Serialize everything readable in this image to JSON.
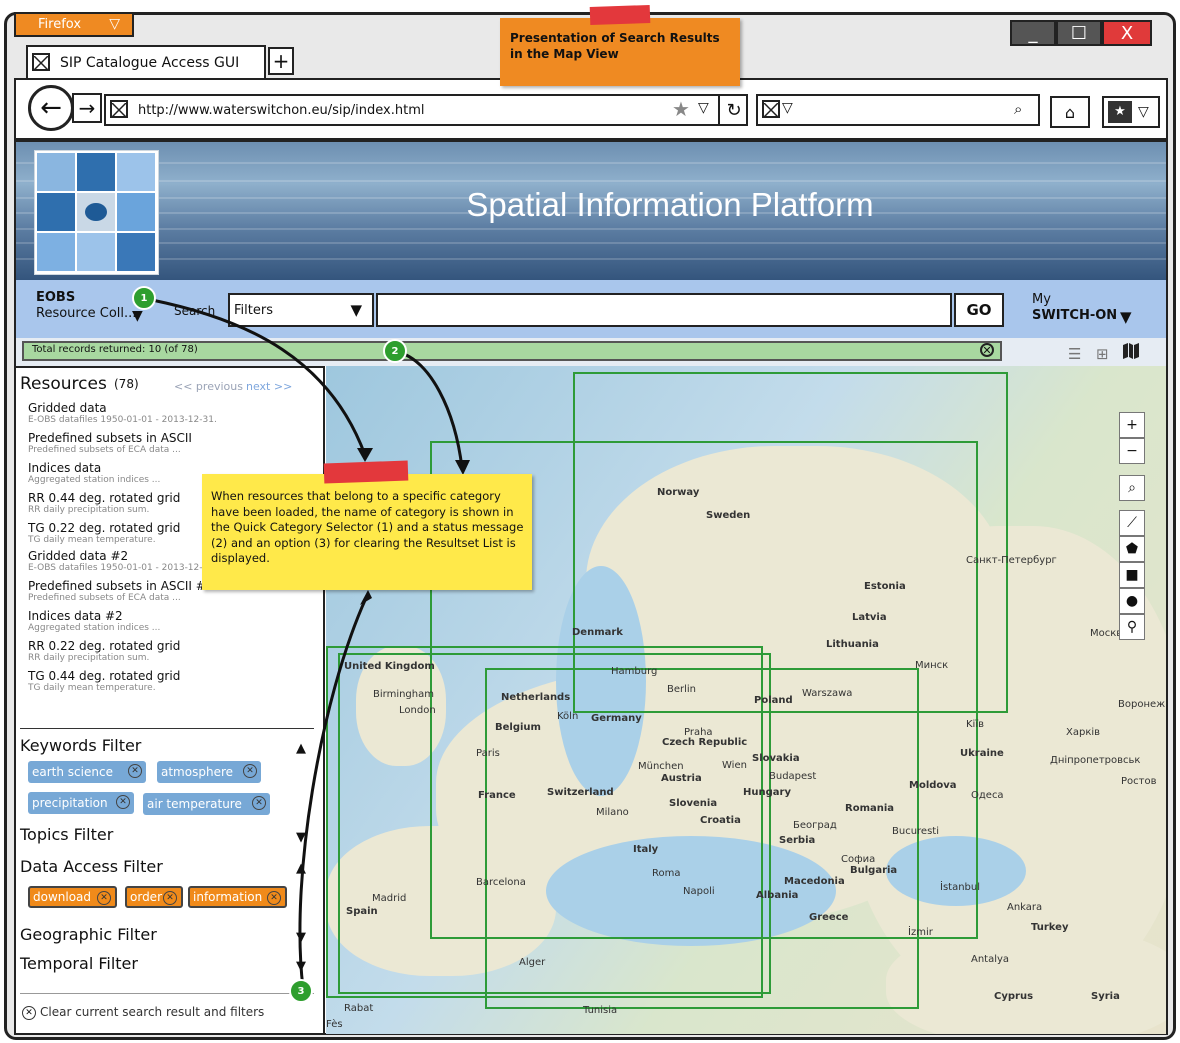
{
  "browser": {
    "app_name": "Firefox",
    "tab_title": "SIP Catalogue Access GUI",
    "new_tab": "+",
    "url": "http://www.waterswitchon.eu/sip/index.html",
    "window_controls": {
      "minimize": "_",
      "maximize": "☐",
      "close": "X"
    }
  },
  "notes": {
    "top": "Presentation of Search Results in the Map View",
    "main": "When resources that belong to a specific category have been loaded, the name of category is shown in the Quick Category Selector (1) and a status message (2) and an option (3) for clearing the Resultset List is displayed.",
    "badges": [
      "1",
      "2",
      "3"
    ]
  },
  "header": {
    "title": "Spatial Information Platform"
  },
  "toolbar": {
    "category": "EOBS",
    "collection": "Resource Coll...",
    "search_label": "Search",
    "filter_select": "Filters",
    "go_label": "GO",
    "my_label": "My",
    "switchon_label": "SWITCH-ON"
  },
  "status": {
    "text": "Total records returned: 10 (of 78)"
  },
  "resources": {
    "title": "Resources",
    "count": "(78)",
    "prev": "<< previous",
    "next": "next >>",
    "items": [
      {
        "title": "Gridded data",
        "sub": "E-OBS datafiles 1950-01-01 - 2013-12-31."
      },
      {
        "title": "Predefined subsets in ASCII",
        "sub": "Predefined subsets of ECA data ..."
      },
      {
        "title": "Indices data",
        "sub": "Aggregated station indices ..."
      },
      {
        "title": "RR 0.44 deg. rotated grid",
        "sub": "RR daily precipitation sum."
      },
      {
        "title": "TG 0.22 deg. rotated grid",
        "sub": "TG daily mean temperature."
      },
      {
        "title": "Gridded data #2",
        "sub": "E-OBS datafiles 1950-01-01 - 2013-12-31."
      },
      {
        "title": "Predefined subsets in ASCII #2",
        "sub": "Predefined subsets of ECA data ..."
      },
      {
        "title": "Indices data #2",
        "sub": "Aggregated station indices ..."
      },
      {
        "title": "RR 0.22 deg. rotated grid",
        "sub": "RR daily precipitation sum."
      },
      {
        "title": "TG 0.44 deg. rotated grid",
        "sub": "TG daily mean temperature."
      }
    ]
  },
  "filters": {
    "keywords": {
      "title": "Keywords Filter",
      "chips": [
        "earth science",
        "atmosphere",
        "precipitation",
        "air temperature"
      ]
    },
    "topics": {
      "title": "Topics Filter"
    },
    "data_access": {
      "title": "Data Access Filter",
      "chips": [
        "download",
        "order",
        "information"
      ]
    },
    "geographic": {
      "title": "Geographic Filter"
    },
    "temporal": {
      "title": "Temporal Filter"
    },
    "clear_all": "Clear current search result and filters"
  },
  "map": {
    "countries": [
      "Norway",
      "Sweden",
      "Estonia",
      "Latvia",
      "Lithuania",
      "Denmark",
      "United Kingdom",
      "Netherlands",
      "Belgium",
      "Germany",
      "Poland",
      "Czech Republic",
      "Slovakia",
      "Austria",
      "Hungary",
      "Ukraine",
      "Moldova",
      "Romania",
      "Switzerland",
      "Slovenia",
      "Croatia",
      "Serbia",
      "Italy",
      "Bulgaria",
      "Macedonia",
      "Albania",
      "Greece",
      "Turkey",
      "Spain",
      "France",
      "Cyprus",
      "Syria"
    ],
    "cities": [
      "Санкт-Петербург",
      "Москва",
      "Минск",
      "Hamburg",
      "Berlin",
      "Warszawa",
      "Birmingham",
      "London",
      "Köln",
      "Praha",
      "Kiїв",
      "Харків",
      "Воронеж",
      "Дніпропетровськ",
      "Ростов",
      "Paris",
      "München",
      "Wien",
      "Budapest",
      "Одеса",
      "Milano",
      "Београд",
      "Bucuresti",
      "Софиа",
      "Roma",
      "Napoli",
      "Barcelona",
      "Madrid",
      "İstanbul",
      "Ankara",
      "İzmir",
      "Antalya",
      "Alger",
      "Tunisia",
      "Fès",
      "Rabat"
    ],
    "controls": [
      "+",
      "−"
    ]
  },
  "colors": {
    "banner": "#4a6d94",
    "toolbar": "#a9c6ec",
    "status": "#a8d8a0",
    "note_orange": "#ef8a22",
    "note_yellow": "#ffe94a",
    "box_green": "#2e9b38",
    "chip_blue": "#77a8d6",
    "chip_orange": "#f08a1a"
  }
}
